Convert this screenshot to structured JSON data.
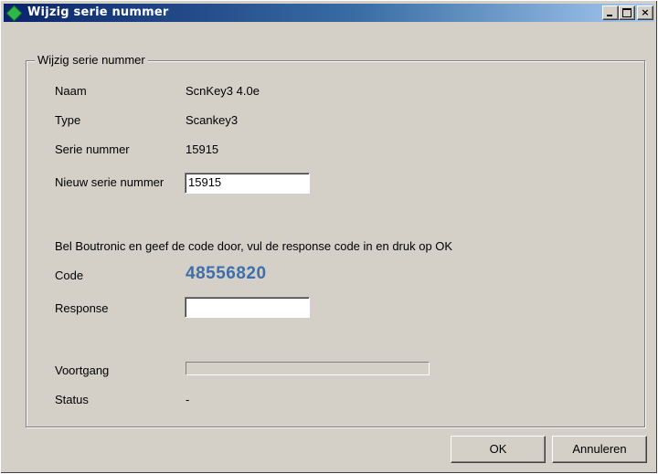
{
  "window": {
    "title": "Wijzig serie nummer",
    "icon": "green-diamond-icon",
    "controls": {
      "minimize": "_",
      "maximize": "□",
      "close": "×"
    }
  },
  "group": {
    "legend": "Wijzig serie nummer"
  },
  "fields": {
    "naam_label": "Naam",
    "naam_value": "ScnKey3 4.0e",
    "type_label": "Type",
    "type_value": "Scankey3",
    "serie_label": "Serie nummer",
    "serie_value": "15915",
    "nieuw_label": "Nieuw serie nummer",
    "nieuw_value": "15915",
    "instruction": "Bel Boutronic en geef de code door, vul de response code in en druk op OK",
    "code_label": "Code",
    "code_value": "48556820",
    "response_label": "Response",
    "response_value": "",
    "voortgang_label": "Voortgang",
    "voortgang_progress": 0,
    "status_label": "Status",
    "status_value": "-"
  },
  "buttons": {
    "ok": "OK",
    "cancel": "Annuleren"
  },
  "colors": {
    "title_gradient_start": "#0a246a",
    "title_gradient_end": "#a6caf0",
    "code_text": "#3d6fad",
    "dialog_face": "#d4d0c8"
  }
}
